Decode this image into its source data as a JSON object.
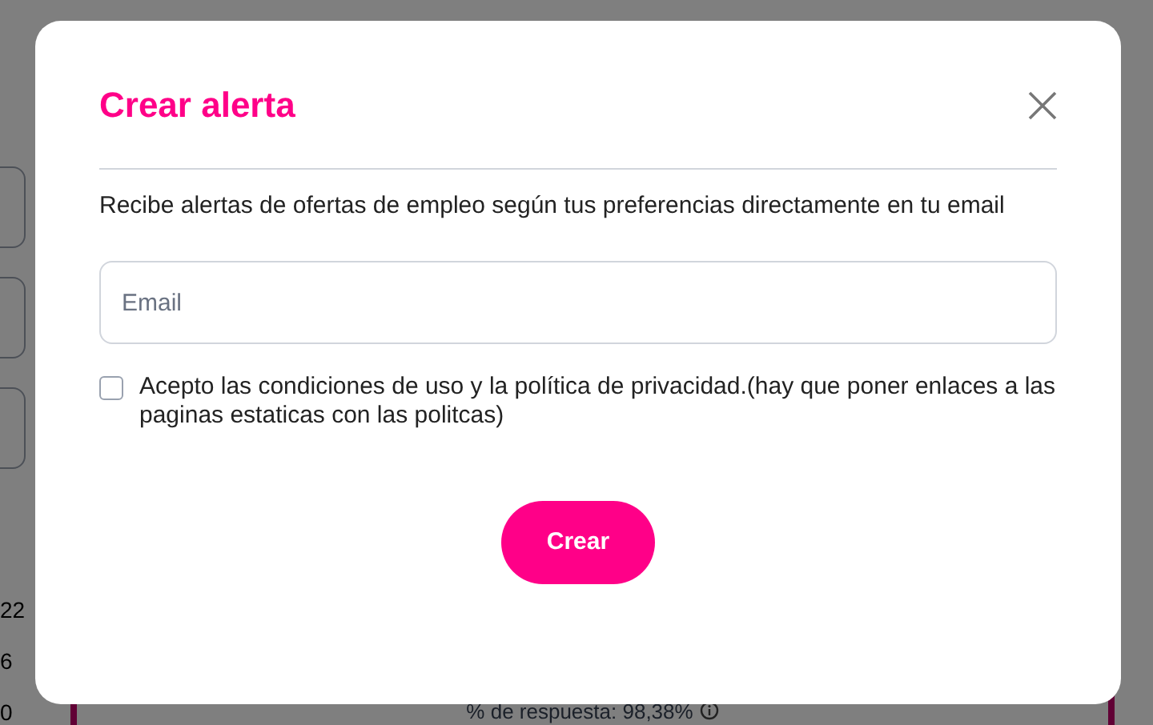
{
  "background": {
    "numbers": [
      "22",
      "6",
      "0"
    ],
    "response_rate": "% de respuesta: 98,38%"
  },
  "modal": {
    "title": "Crear alerta",
    "description": "Recibe alertas de ofertas de empleo según tus preferencias directamente en tu email",
    "email": {
      "placeholder": "Email"
    },
    "consent": {
      "label": "Acepto las condiciones de uso y la política de privacidad.(hay que poner enlaces a las paginas estaticas con las politcas)",
      "checked": false
    },
    "submit": "Crear"
  }
}
